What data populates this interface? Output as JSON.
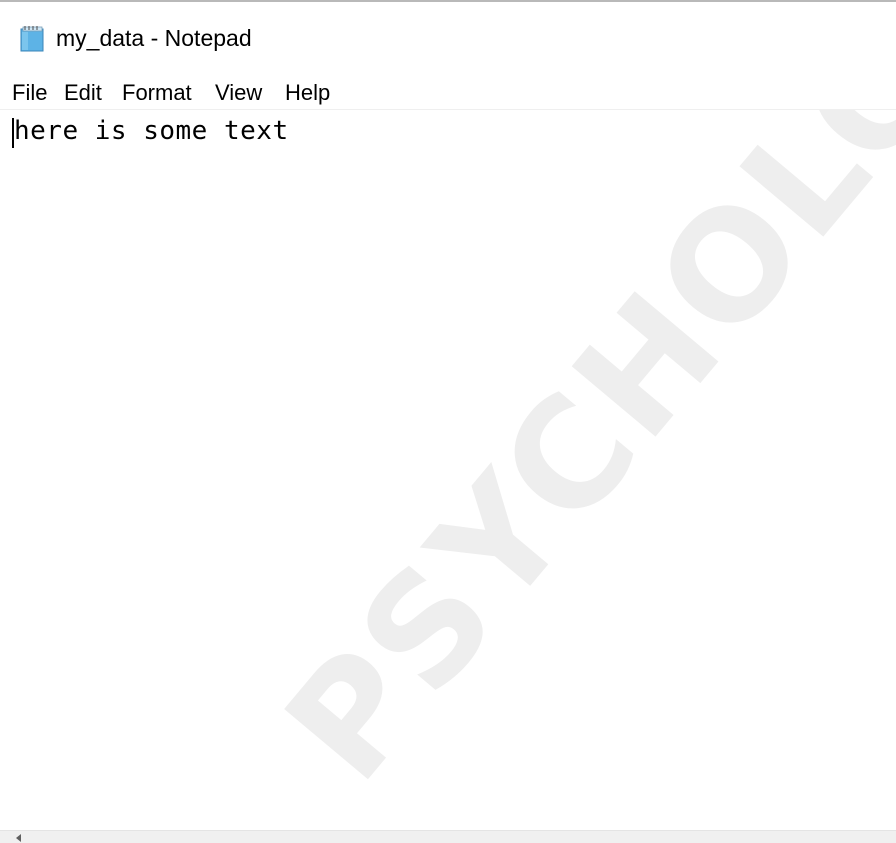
{
  "window": {
    "title": "my_data - Notepad",
    "icon": "notepad-icon"
  },
  "menu": {
    "items": [
      {
        "label": "File"
      },
      {
        "label": "Edit"
      },
      {
        "label": "Format"
      },
      {
        "label": "View"
      },
      {
        "label": "Help"
      }
    ]
  },
  "editor": {
    "content": "here is some text"
  },
  "watermark": {
    "text": "PSYCHOLOGY"
  },
  "colors": {
    "background": "#ffffff",
    "text": "#000000",
    "window_border": "#b9b9b9",
    "scrollbar": "#f0f0f0",
    "watermark": "#eeeeee"
  }
}
